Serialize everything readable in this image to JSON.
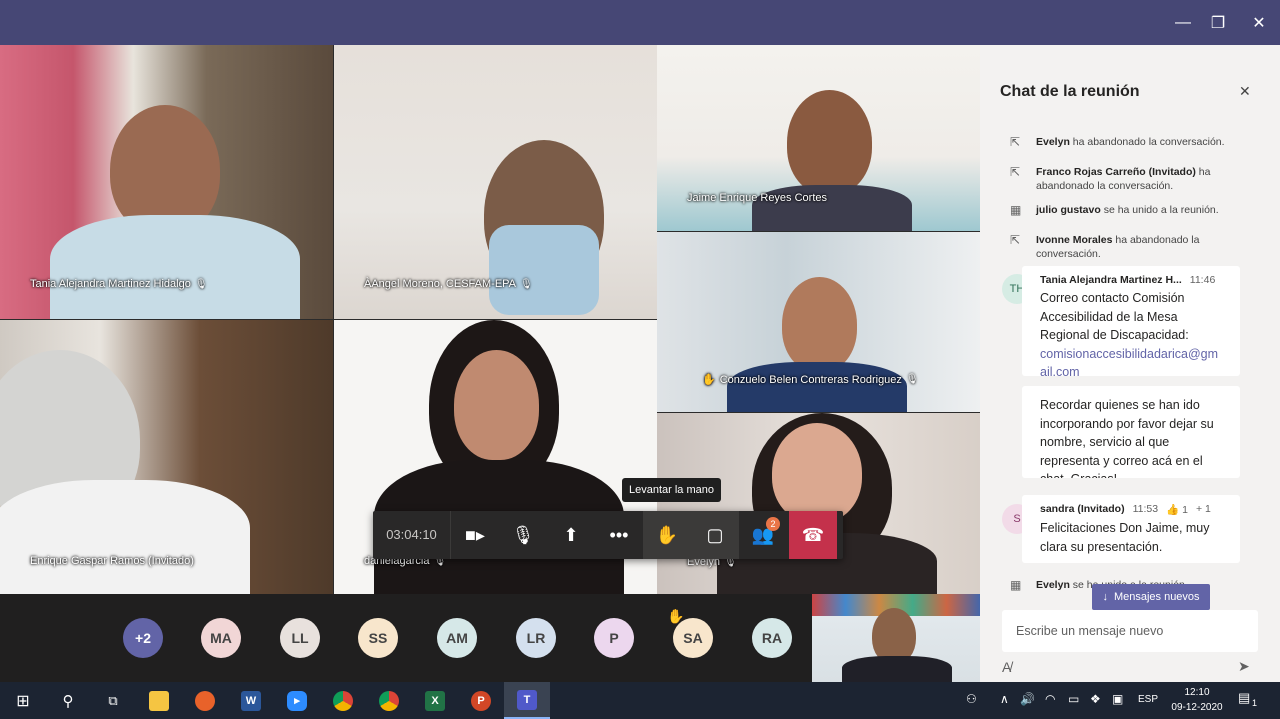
{
  "window": {
    "controls": {
      "minimize": "—",
      "maximize": "❐",
      "close": "✕"
    }
  },
  "tiles": [
    {
      "name": "Tania Alejandra Martinez Hidalgo"
    },
    {
      "name": "ÀAngel Moreno, CESFAM-EPA"
    },
    {
      "name": "Jaime Enrique Reyes Cortes"
    },
    {
      "name": "Conzuelo Belen Contreras Rodriguez"
    },
    {
      "name": "Enrique Gaspar Ramos (Invitado)"
    },
    {
      "name": "danielagarcia"
    },
    {
      "name": "Evelyn"
    }
  ],
  "controls": {
    "timer": "03:04:10",
    "tooltip": "Levantar la mano",
    "participants_badge": "2"
  },
  "strip": {
    "overflow": "+2",
    "avatars": [
      "MA",
      "LL",
      "SS",
      "AM",
      "LR",
      "P",
      "SA",
      "RA"
    ],
    "colors": {
      "overflow": "#6264a7",
      "MA": "#f1d6d6",
      "LL": "#e8e1dd",
      "SS": "#f8e6cc",
      "AM": "#d6e8e8",
      "LR": "#d4e0ee",
      "P": "#ecd7ee",
      "SA": "#f8e6cc",
      "RA": "#d6e8e8"
    }
  },
  "chat": {
    "title": "Chat de la reunión",
    "close": "✕",
    "events": [
      {
        "name": "Evelyn",
        "text": "ha abandonado la conversación.",
        "icon": "leave-icon"
      },
      {
        "name": "Franco Rojas Carreño (Invitado)",
        "text": "ha abandonado la conversación.",
        "icon": "leave-icon"
      },
      {
        "name": "julio gustavo",
        "text": "se ha unido a la reunión.",
        "icon": "join-icon"
      },
      {
        "name": "Ivonne Morales",
        "text": "ha abandonado la conversación.",
        "icon": "leave-icon"
      }
    ],
    "messages": [
      {
        "initials": "TH",
        "sender": "Tania Alejandra Martinez H...",
        "time": "11:46",
        "text": "Correo contacto Comisión Accesibilidad de la Mesa Regional de Discapacidad:",
        "link": "comisionaccesibilidadarica@gm ail.com"
      },
      {
        "text": "Recordar quienes se han ido incorporando por favor dejar su nombre, servicio al que representa y correo acá en el chat. Gracias!"
      },
      {
        "initials": "S",
        "sender": "sandra (Invitado)",
        "time": "11:53",
        "reaction": "👍 1",
        "reaction_more": "+ 1",
        "text": "Felicitaciones Don Jaime, muy clara su presentación."
      }
    ],
    "last_event": {
      "name": "Evelyn",
      "text": "se ha unido a la reunión."
    },
    "new_messages": "Mensajes nuevos",
    "compose_placeholder": "Escribe un mensaje nuevo"
  },
  "taskbar": {
    "lang": "ESP",
    "time": "12:10",
    "date": "09-12-2020",
    "notifications": "1"
  }
}
